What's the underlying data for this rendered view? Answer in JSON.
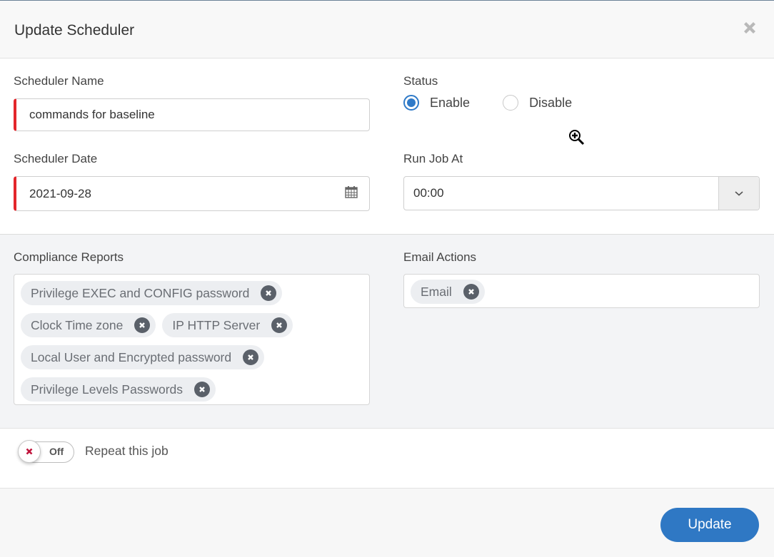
{
  "dialog": {
    "title": "Update Scheduler",
    "close_icon": "close-icon"
  },
  "form": {
    "scheduler_name": {
      "label": "Scheduler Name",
      "value": "commands for baseline"
    },
    "status": {
      "label": "Status",
      "options": [
        {
          "label": "Enable",
          "checked": true
        },
        {
          "label": "Disable",
          "checked": false
        }
      ]
    },
    "scheduler_date": {
      "label": "Scheduler Date",
      "value": "2021-09-28",
      "icon": "calendar-icon"
    },
    "run_job_at": {
      "label": "Run Job At",
      "value": "00:00",
      "icon": "chevron-down-icon"
    },
    "compliance_reports": {
      "label": "Compliance Reports",
      "tags": [
        "Privilege EXEC and CONFIG password",
        "Clock Time zone",
        "IP HTTP Server",
        "Local User and Encrypted password",
        "Privilege Levels Passwords"
      ]
    },
    "email_actions": {
      "label": "Email Actions",
      "tags": [
        "Email"
      ]
    },
    "repeat": {
      "toggle_text": "Off",
      "state": "off",
      "label": "Repeat this job"
    }
  },
  "footer": {
    "update_label": "Update"
  },
  "colors": {
    "accent": "#2f78c4",
    "required": "#e3262b",
    "toggle_off_icon": "#c0143c"
  }
}
